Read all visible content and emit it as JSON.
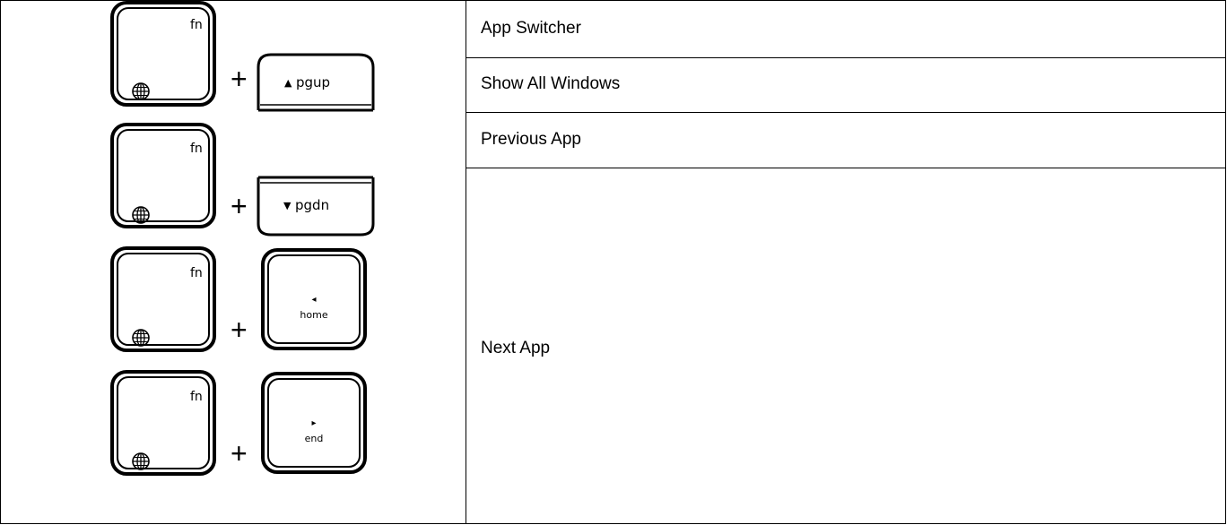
{
  "rows": [
    {
      "modifier": {
        "label": "fn",
        "icon": "globe-icon"
      },
      "plus": "+",
      "key": {
        "arrow": "▲",
        "label": "pgup",
        "arrow_icon": "up-triangle-icon"
      },
      "description": "App Switcher"
    },
    {
      "modifier": {
        "label": "fn",
        "icon": "globe-icon"
      },
      "plus": "+",
      "key": {
        "arrow": "▼",
        "label": "pgdn",
        "arrow_icon": "down-triangle-icon"
      },
      "description": "Show All Windows"
    },
    {
      "modifier": {
        "label": "fn",
        "icon": "globe-icon"
      },
      "plus": "+",
      "key": {
        "arrow": "◂",
        "label": "home",
        "arrow_icon": "left-triangle-icon"
      },
      "description": "Previous App"
    },
    {
      "modifier": {
        "label": "fn",
        "icon": "globe-icon"
      },
      "plus": "+",
      "key": {
        "arrow": "▸",
        "label": "end",
        "arrow_icon": "right-triangle-icon"
      },
      "description": "Next App"
    }
  ]
}
